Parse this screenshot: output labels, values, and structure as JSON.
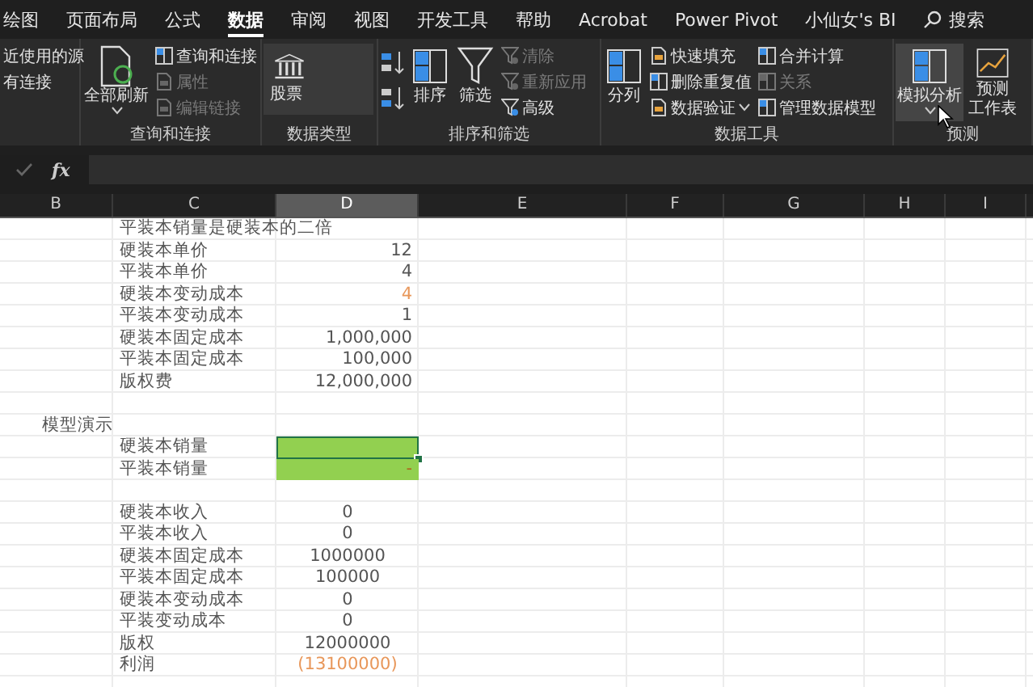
{
  "tabs": [
    {
      "label": "绘图",
      "selected": false
    },
    {
      "label": "页面布局",
      "selected": false
    },
    {
      "label": "公式",
      "selected": false
    },
    {
      "label": "数据",
      "selected": true
    },
    {
      "label": "审阅",
      "selected": false
    },
    {
      "label": "视图",
      "selected": false
    },
    {
      "label": "开发工具",
      "selected": false
    },
    {
      "label": "帮助",
      "selected": false
    },
    {
      "label": "Acrobat",
      "selected": false
    },
    {
      "label": "Power Pivot",
      "selected": false
    },
    {
      "label": "小仙女's BI",
      "selected": false
    }
  ],
  "search": {
    "label": "搜索"
  },
  "ribbon_groups": [
    {
      "columns": [
        {
          "kind": "stack",
          "items": [
            {
              "label": "近使用的源",
              "disabled": false
            },
            {
              "label": "有连接",
              "disabled": false
            }
          ]
        }
      ]
    },
    {
      "label": "查询和连接",
      "columns": [
        {
          "kind": "big",
          "label": "全部刷新",
          "caret": true,
          "selected": false
        },
        {
          "kind": "stack",
          "items": [
            {
              "label": "查询和连接",
              "disabled": false
            },
            {
              "label": "属性",
              "disabled": true
            },
            {
              "label": "编辑链接",
              "disabled": true
            }
          ]
        }
      ]
    },
    {
      "label": "数据类型",
      "columns": [
        {
          "kind": "gallery",
          "label": "股票"
        }
      ]
    },
    {
      "label": "排序和筛选",
      "columns": [
        {
          "kind": "icons"
        },
        {
          "kind": "big",
          "label": "排序",
          "selected": false
        },
        {
          "kind": "big",
          "label": "筛选",
          "selected": false
        },
        {
          "kind": "stack",
          "items": [
            {
              "label": "清除",
              "disabled": true
            },
            {
              "label": "重新应用",
              "disabled": true
            },
            {
              "label": "高级",
              "disabled": false
            }
          ]
        }
      ]
    },
    {
      "label": "数据工具",
      "columns": [
        {
          "kind": "big",
          "label": "分列",
          "selected": false
        },
        {
          "kind": "stack",
          "items": [
            {
              "label": "快速填充",
              "disabled": false
            },
            {
              "label": "删除重复值",
              "disabled": false
            },
            {
              "label": "数据验证",
              "disabled": false,
              "caret": true
            }
          ]
        },
        {
          "kind": "stack",
          "items": [
            {
              "label": "合并计算",
              "disabled": false
            },
            {
              "label": "关系",
              "disabled": true
            },
            {
              "label": "管理数据模型",
              "disabled": false
            }
          ]
        }
      ]
    },
    {
      "label": "预测",
      "columns": [
        {
          "kind": "big",
          "label": "模拟分析",
          "caret": true,
          "selected": true
        },
        {
          "kind": "big",
          "label": "预测工作表",
          "selected": false
        }
      ]
    }
  ],
  "formula_bar": {
    "fx": "fx"
  },
  "columns": [
    {
      "label": "B",
      "selected": false
    },
    {
      "label": "C",
      "selected": false
    },
    {
      "label": "D",
      "selected": true
    },
    {
      "label": "E",
      "selected": false
    },
    {
      "label": "F",
      "selected": false
    },
    {
      "label": "G",
      "selected": false
    },
    {
      "label": "H",
      "selected": false
    },
    {
      "label": "I",
      "selected": false
    }
  ],
  "rows": [
    {
      "kind": "param",
      "c": "平装本销量是硬装本的二倍"
    },
    {
      "kind": "param",
      "c": "硬装本单价",
      "d": {
        "text": "12",
        "accent": false
      }
    },
    {
      "kind": "param",
      "c": "平装本单价",
      "d": {
        "text": "4",
        "accent": false
      }
    },
    {
      "kind": "param",
      "c": "硬装本变动成本",
      "d": {
        "text": "4",
        "accent": true
      }
    },
    {
      "kind": "param",
      "c": "平装本变动成本",
      "d": {
        "text": "1",
        "accent": false
      }
    },
    {
      "kind": "param",
      "c": "硬装本固定成本",
      "d": {
        "text": "1,000,000",
        "accent": false
      }
    },
    {
      "kind": "param",
      "c": "平装本固定成本",
      "d": {
        "text": "100,000",
        "accent": false
      }
    },
    {
      "kind": "param",
      "c": "版权费",
      "d": {
        "text": "12,000,000",
        "accent": false
      }
    },
    {
      "kind": "blank"
    },
    {
      "kind": "param",
      "b": "模型演示"
    },
    {
      "kind": "param",
      "c": "硬装本销量",
      "d": {
        "filled": true,
        "active": true
      }
    },
    {
      "kind": "param",
      "c": "平装本销量",
      "d": {
        "text": "-",
        "accent": true,
        "filled": true,
        "active": false
      }
    },
    {
      "kind": "blank"
    },
    {
      "kind": "calc",
      "c": "硬装本收入",
      "d": {
        "text": "0",
        "accent": false
      }
    },
    {
      "kind": "calc",
      "c": "平装本收入",
      "d": {
        "text": "0",
        "accent": false
      }
    },
    {
      "kind": "calc",
      "c": "硬装本固定成本",
      "d": {
        "text": "1000000",
        "accent": false
      }
    },
    {
      "kind": "calc",
      "c": "平装本固定成本",
      "d": {
        "text": "100000",
        "accent": false
      }
    },
    {
      "kind": "calc",
      "c": "硬装本变动成本",
      "d": {
        "text": "0",
        "accent": false
      }
    },
    {
      "kind": "calc",
      "c": "平装变动成本",
      "d": {
        "text": "0",
        "accent": false
      }
    },
    {
      "kind": "calc",
      "c": "版权",
      "d": {
        "text": "12000000",
        "accent": false
      }
    },
    {
      "kind": "calc",
      "c": "利润",
      "d": {
        "text": "(13100000)",
        "accent": true
      }
    }
  ]
}
